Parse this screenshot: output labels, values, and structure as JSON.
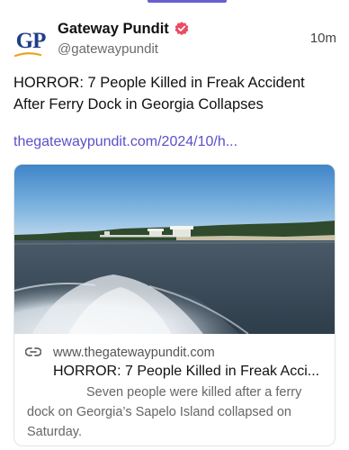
{
  "post": {
    "author": {
      "display_name": "Gateway Pundit",
      "handle": "@gatewaypundit",
      "avatar_text": "GP",
      "verified": true
    },
    "timestamp": "10m",
    "text": "HORROR: 7 People Killed in Freak Accident After Ferry Dock in Georgia Collapses",
    "link_text": "thegatewaypundit.com/2024/10/h..."
  },
  "card": {
    "domain": "www.thegatewaypundit.com",
    "title": "HORROR: 7 People Killed in Freak Acci...",
    "description": "Seven people were killed after a ferry dock on Georgia’s Sapelo Island collapsed on Saturday."
  },
  "icons": {
    "verified": "verified-badge-icon",
    "link": "link-icon"
  },
  "colors": {
    "accent": "#6a5fd0",
    "link": "#5b4fc9",
    "verified": "#ea4c61",
    "avatar_blue": "#1f3f86",
    "avatar_gold": "#e8a51d"
  }
}
